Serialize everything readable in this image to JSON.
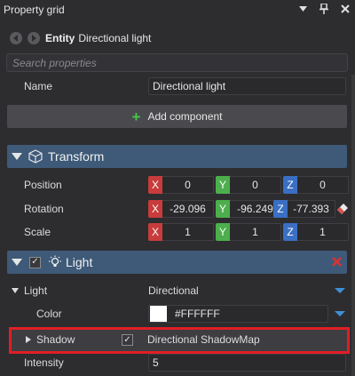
{
  "window": {
    "title": "Property grid",
    "buttons": [
      "dropdown-icon",
      "pin-icon",
      "close-icon"
    ]
  },
  "entity": {
    "kind_label": "Entity",
    "name": "Directional light"
  },
  "search": {
    "placeholder": "Search properties",
    "value": ""
  },
  "name_row": {
    "label": "Name",
    "value": "Directional light"
  },
  "add_component": {
    "label": "Add component"
  },
  "transform": {
    "title": "Transform",
    "rows": [
      {
        "label": "Position",
        "x": "0",
        "y": "0",
        "z": "0"
      },
      {
        "label": "Rotation",
        "x": "-29.096",
        "y": "-96.249",
        "z": "-77.393"
      },
      {
        "label": "Scale",
        "x": "1",
        "y": "1",
        "z": "1"
      }
    ],
    "axis_labels": {
      "x": "X",
      "y": "Y",
      "z": "Z"
    }
  },
  "light_component": {
    "title": "Light",
    "enabled": true,
    "light": {
      "label": "Light",
      "value": "Directional"
    },
    "color": {
      "label": "Color",
      "value": "#FFFFFF",
      "swatch": "#ffffff"
    },
    "shadow": {
      "label": "Shadow",
      "enabled": true,
      "value": "Directional ShadowMap"
    },
    "intensity": {
      "label": "Intensity",
      "value": "5"
    }
  },
  "colors": {
    "section_header": "#3e5a78",
    "highlight_border": "#e01e26",
    "axis_x": "#c83c3c",
    "axis_y": "#4caf4c",
    "axis_z": "#3a6fc4",
    "add_plus": "#47c447"
  }
}
